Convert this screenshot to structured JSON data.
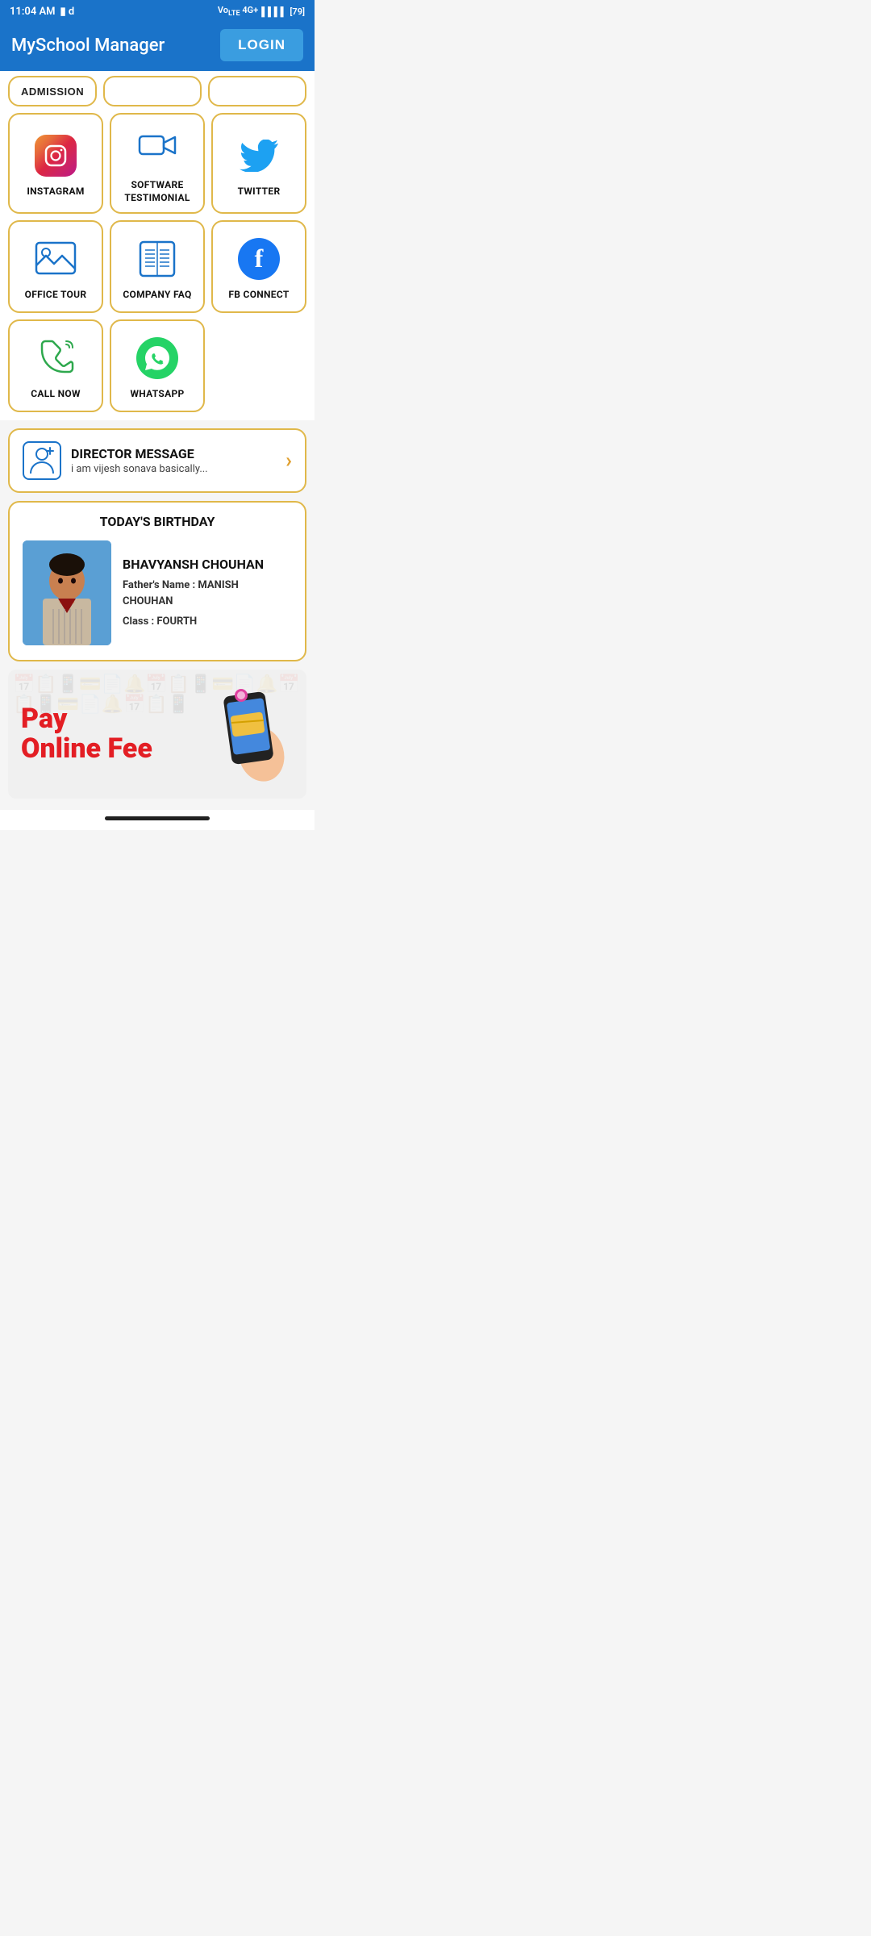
{
  "statusBar": {
    "time": "11:04 AM",
    "network": "4G+",
    "battery": "79"
  },
  "header": {
    "title": "MySchool Manager",
    "loginLabel": "LOGIN"
  },
  "admissionRow": {
    "label": "ADMISSION"
  },
  "gridRow1": [
    {
      "id": "instagram",
      "label": "INSTAGRAM",
      "icon": "instagram"
    },
    {
      "id": "software-testimonial",
      "label": "SOFTWARE\nTESTIMONIAL",
      "icon": "video"
    },
    {
      "id": "twitter",
      "label": "TWITTER",
      "icon": "twitter"
    }
  ],
  "gridRow2": [
    {
      "id": "office-tour",
      "label": "OFFICE TOUR",
      "icon": "image"
    },
    {
      "id": "company-faq",
      "label": "COMPANY FAQ",
      "icon": "book"
    },
    {
      "id": "fb-connect",
      "label": "FB CONNECT",
      "icon": "facebook"
    }
  ],
  "gridRow3": [
    {
      "id": "call-now",
      "label": "CALL NOW",
      "icon": "phone"
    },
    {
      "id": "whatsapp",
      "label": "WHATSAPP",
      "icon": "whatsapp"
    }
  ],
  "directorMessage": {
    "title": "DIRECTOR MESSAGE",
    "subtitle": "i am vijesh sonava basically..."
  },
  "birthday": {
    "sectionTitle": "TODAY'S BIRTHDAY",
    "name": "BHAVYANSH CHOUHAN",
    "fatherLabel": "Father's Name :",
    "fatherName": "MANISH CHOUHAN",
    "classLabel": "Class :",
    "className": "FOURTH"
  },
  "payBanner": {
    "line1": "Pay",
    "line2": "Online Fee"
  }
}
